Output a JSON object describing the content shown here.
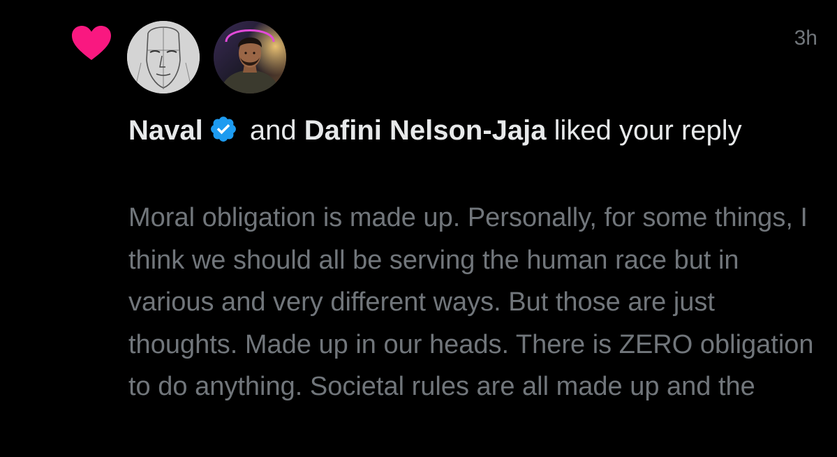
{
  "notification": {
    "type_icon": "heart-icon",
    "heart_color": "#f91880",
    "timestamp": "3h",
    "users": [
      {
        "name": "Naval",
        "verified": true,
        "avatar_icon": "sketch-face-avatar"
      },
      {
        "name": "Dafini Nelson-Jaja",
        "verified": false,
        "avatar_icon": "portrait-avatar"
      }
    ],
    "connector": "and",
    "action_text": "liked your reply",
    "reply_text": "Moral obligation is made up. Personally, for some things, I think we should all be serving the human race but in various and very different ways. But those are just thoughts. Made up in our heads. There is ZERO obligation to do anything. Societal rules are all made up and the",
    "verified_color": "#1d9bf0",
    "text_color": "#e7e9ea",
    "secondary_color": "#71767b"
  }
}
